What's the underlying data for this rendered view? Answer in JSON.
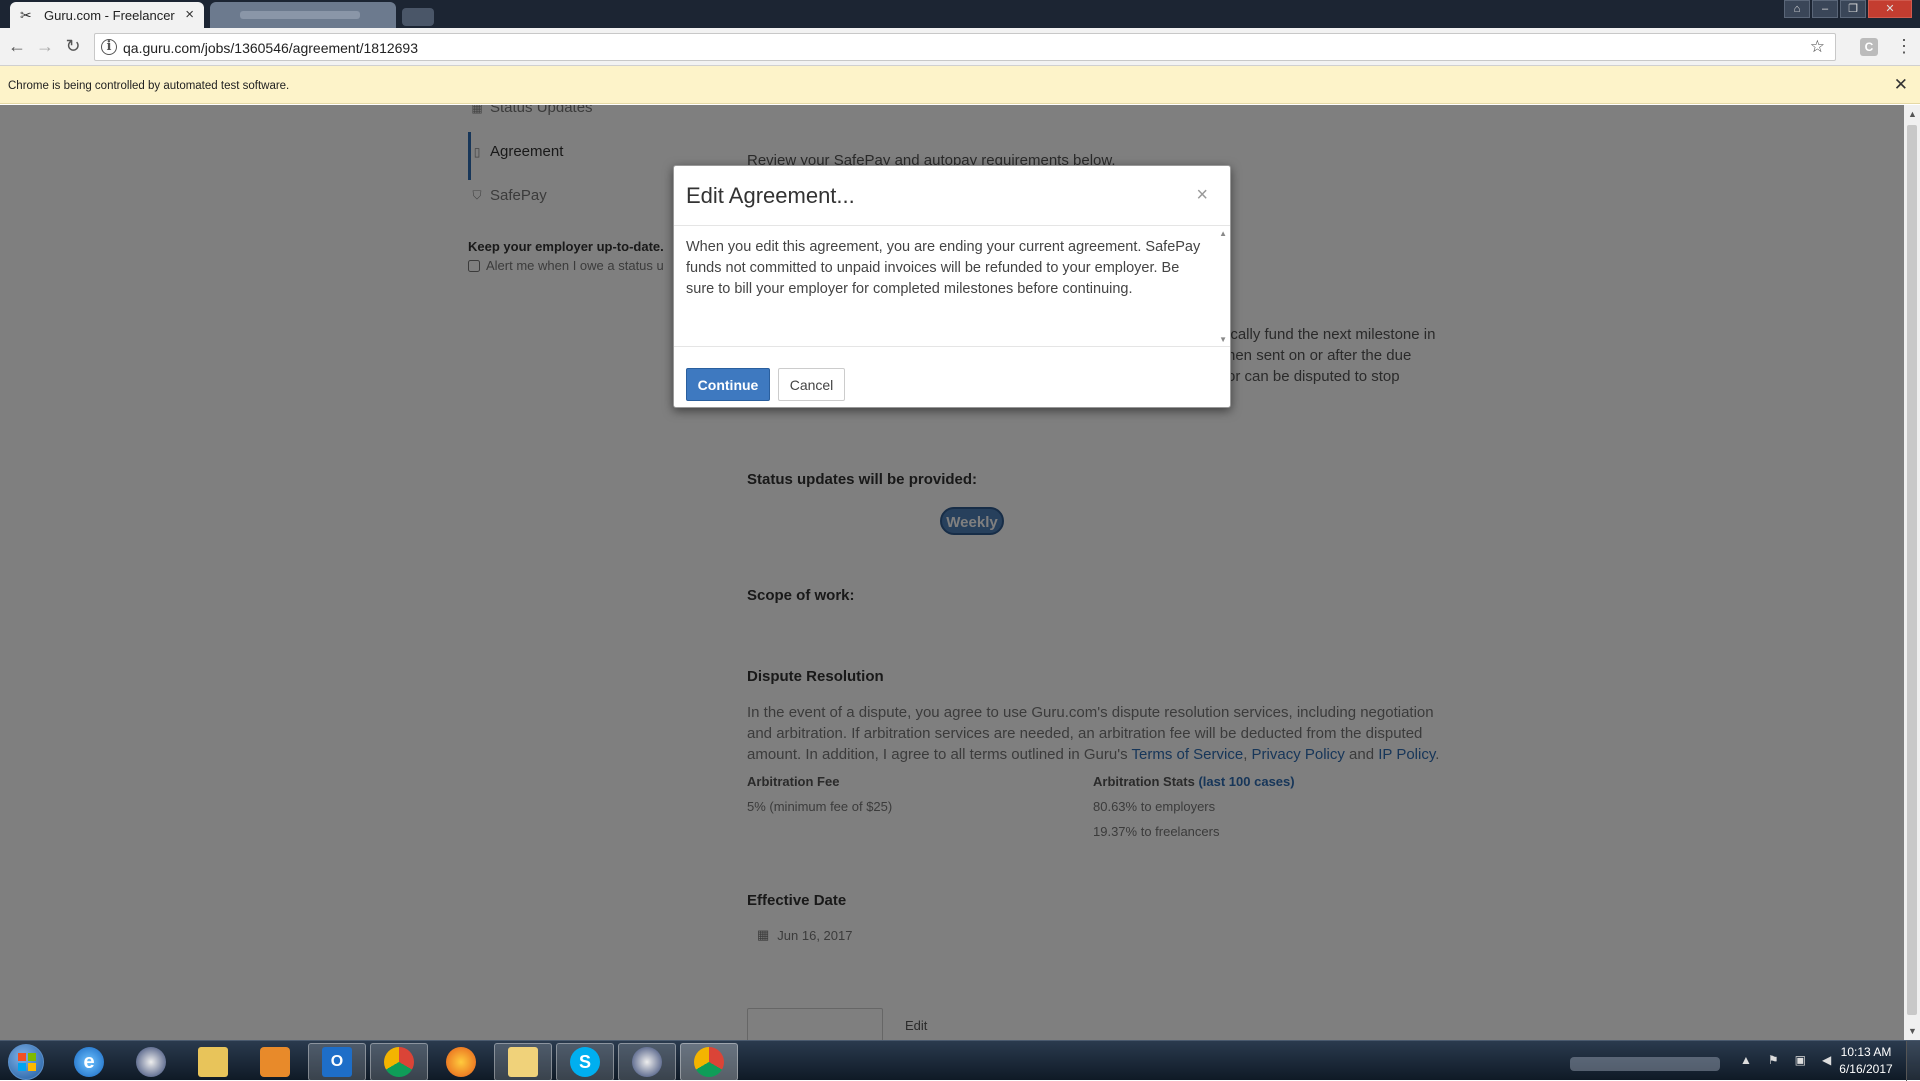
{
  "browser": {
    "active_tab_title": "Guru.com - Freelancer",
    "url": "qa.guru.com/jobs/1360546/agreement/1812693",
    "infobar_text": "Chrome is being controlled by automated test software.",
    "ext_letter": "C"
  },
  "sidebar": {
    "items": [
      {
        "label": "Status Updates",
        "icon": "calendar-icon"
      },
      {
        "label": "Agreement",
        "icon": "document-icon"
      },
      {
        "label": "SafePay",
        "icon": "shield-icon"
      }
    ],
    "keep_label": "Keep your employer up-to-date.",
    "alert_label": "Alert me when I owe a status u"
  },
  "content": {
    "safepay_heading": "Review your SafePay and autopay requirements below.",
    "autopay_line1": "ically fund the next milestone in",
    "autopay_line2": "hen sent on or after the due",
    "autopay_line3": "or can be disputed to stop",
    "status_heading": "Status updates will be provided:",
    "status_value": "Weekly",
    "scope_heading": "Scope of work:",
    "dispute_heading": "Dispute Resolution",
    "dispute_text_1": "In the event of a dispute, you agree to use Guru.com's dispute resolution services, including negotiation and arbitration. If arbitration services are needed, an arbitration fee will be deducted from the disputed amount. In addition, I agree to all terms outlined in Guru's ",
    "terms_link": "Terms of Service",
    "sep_comma": ", ",
    "privacy_link": "Privacy Policy",
    "sep_and": " and ",
    "ip_link": "IP Policy",
    "end_period": ".",
    "arb_fee_label": "Arbitration Fee",
    "arb_fee_value": "5% (minimum fee of $25)",
    "arb_stats_label": "Arbitration Stats",
    "arb_stats_link": "(last 100 cases)",
    "stat_employers": "80.63% to employers",
    "stat_freelancers": "19.37% to freelancers",
    "effective_heading": "Effective Date",
    "effective_date": "Jun 16, 2017",
    "edit_label": "Edit"
  },
  "modal": {
    "title": "Edit Agreement...",
    "close": "×",
    "body": "When you edit this agreement, you are ending your current agreement. SafePay funds not committed to unpaid invoices will be refunded to your employer. Be sure to bill your employer for completed milestones before continuing.",
    "continue_label": "Continue",
    "cancel_label": "Cancel"
  },
  "taskbar": {
    "apps": [
      "internet-explorer",
      "app-2",
      "file-explorer",
      "media-player",
      "outlook",
      "chrome",
      "firefox",
      "folder-app",
      "skype",
      "app-10",
      "chrome-active"
    ],
    "clock_time": "10:13 AM",
    "clock_date": "6/16/2017"
  },
  "colors": {
    "accent": "#3e79c0",
    "infobar": "#fdf3c9",
    "titlebar": "#1c2533"
  }
}
